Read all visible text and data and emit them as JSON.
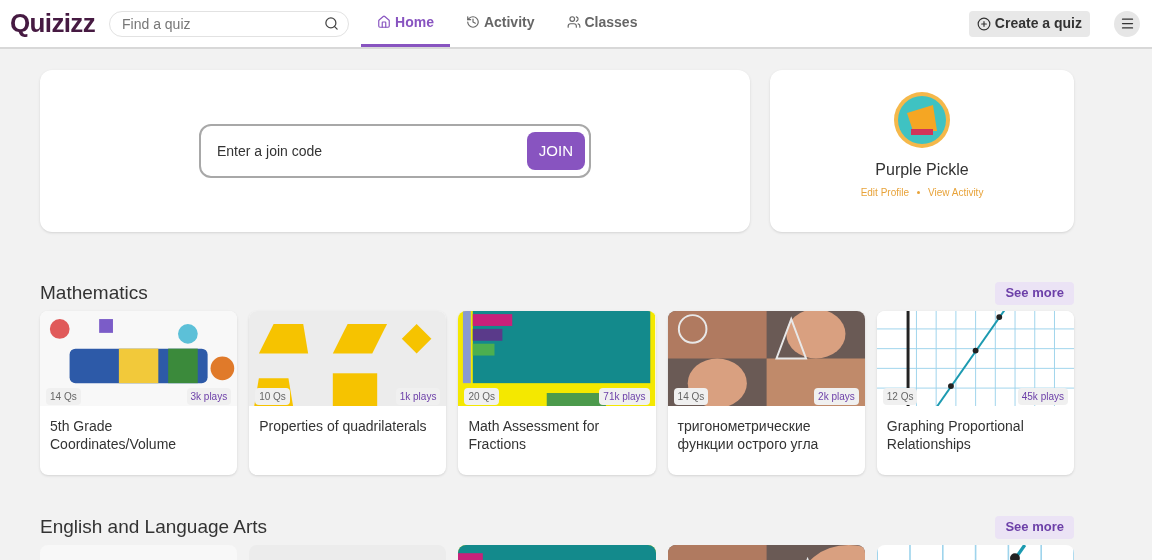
{
  "header": {
    "logo": "Quizizz",
    "search": {
      "placeholder": "Find a quiz"
    },
    "tabs": [
      {
        "label": "Home",
        "selected": true
      },
      {
        "label": "Activity",
        "selected": false
      },
      {
        "label": "Classes",
        "selected": false
      }
    ],
    "create_button": "Create a quiz"
  },
  "join": {
    "placeholder": "Enter a join code",
    "button": "JOIN"
  },
  "profile": {
    "name": "Purple Pickle",
    "links": [
      "Edit Profile",
      "View Activity"
    ]
  },
  "sections": [
    {
      "title": "Mathematics",
      "see_more": "See more",
      "quizzes": [
        {
          "questions": "14 Qs",
          "plays": "3k plays",
          "title": "5th Grade Coordinates/Volume"
        },
        {
          "questions": "10 Qs",
          "plays": "1k plays",
          "title": "Properties of quadrilaterals"
        },
        {
          "questions": "20 Qs",
          "plays": "71k plays",
          "title": "Math Assessment for Fractions"
        },
        {
          "questions": "14 Qs",
          "plays": "2k plays",
          "title": "тригонометрические функции острого угла"
        },
        {
          "questions": "12 Qs",
          "plays": "45k plays",
          "title": "Graphing Proportional Relationships"
        }
      ]
    },
    {
      "title": "English and Language Arts",
      "see_more": "See more"
    }
  ]
}
